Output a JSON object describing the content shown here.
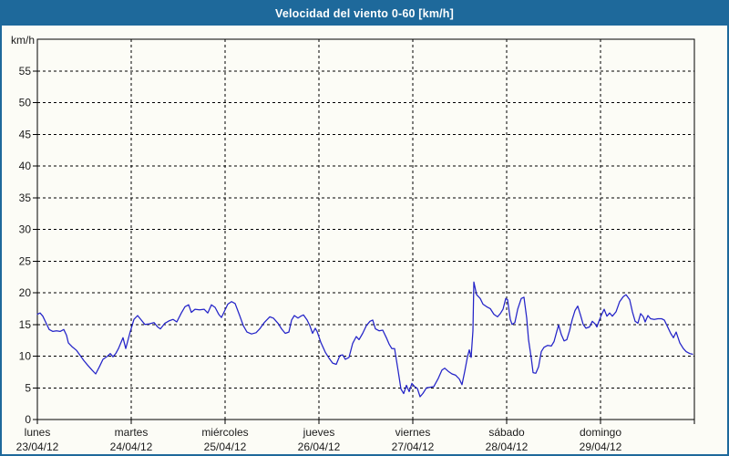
{
  "window": {
    "title": "Velocidad del viento 0-60 [km/h]"
  },
  "colors": {
    "titlebar_bg": "#1e699b",
    "frame_border": "#1e699b",
    "panel_bg": "#fcfcf6",
    "grid": "#000000",
    "axis_text": "#1a1a1a",
    "series_line": "#2323c8"
  },
  "chart_data": {
    "type": "line",
    "title": "Velocidad del viento 0-60 [km/h]",
    "xlabel": "",
    "ylabel": "km/h",
    "ylim": [
      0,
      60
    ],
    "yticks": [
      0,
      5,
      10,
      15,
      20,
      25,
      30,
      35,
      40,
      45,
      50,
      55
    ],
    "grid": "dashed",
    "legend_position": "none",
    "x_days": 7,
    "days": [
      {
        "name": "lunes",
        "date": "23/04/12"
      },
      {
        "name": "martes",
        "date": "24/04/12"
      },
      {
        "name": "miércoles",
        "date": "25/04/12"
      },
      {
        "name": "jueves",
        "date": "26/04/12"
      },
      {
        "name": "viernes",
        "date": "27/04/12"
      },
      {
        "name": "sábado",
        "date": "28/04/12"
      },
      {
        "name": "domingo",
        "date": "29/04/12"
      }
    ],
    "series": [
      {
        "name": "Velocidad del viento",
        "color": "#2323c8",
        "points": [
          [
            0.0,
            16.6
          ],
          [
            0.029,
            16.8
          ],
          [
            0.058,
            16.3
          ],
          [
            0.087,
            15.4
          ],
          [
            0.126,
            14.2
          ],
          [
            0.165,
            13.9
          ],
          [
            0.204,
            14.0
          ],
          [
            0.243,
            13.9
          ],
          [
            0.282,
            14.2
          ],
          [
            0.311,
            13.3
          ],
          [
            0.33,
            12.1
          ],
          [
            0.369,
            11.5
          ],
          [
            0.417,
            10.9
          ],
          [
            0.456,
            10.1
          ],
          [
            0.495,
            9.3
          ],
          [
            0.534,
            8.6
          ],
          [
            0.583,
            7.8
          ],
          [
            0.621,
            7.2
          ],
          [
            0.66,
            8.3
          ],
          [
            0.699,
            9.5
          ],
          [
            0.748,
            10.0
          ],
          [
            0.777,
            10.4
          ],
          [
            0.806,
            9.9
          ],
          [
            0.835,
            10.4
          ],
          [
            0.864,
            11.2
          ],
          [
            0.913,
            12.9
          ],
          [
            0.942,
            11.2
          ],
          [
            0.99,
            13.9
          ],
          [
            1.029,
            15.8
          ],
          [
            1.068,
            16.4
          ],
          [
            1.107,
            15.7
          ],
          [
            1.146,
            15.0
          ],
          [
            1.194,
            15.1
          ],
          [
            1.243,
            15.3
          ],
          [
            1.282,
            14.6
          ],
          [
            1.311,
            14.3
          ],
          [
            1.359,
            15.2
          ],
          [
            1.408,
            15.6
          ],
          [
            1.447,
            15.8
          ],
          [
            1.485,
            15.4
          ],
          [
            1.534,
            16.8
          ],
          [
            1.573,
            17.8
          ],
          [
            1.612,
            18.1
          ],
          [
            1.641,
            16.9
          ],
          [
            1.68,
            17.4
          ],
          [
            1.728,
            17.3
          ],
          [
            1.777,
            17.4
          ],
          [
            1.816,
            16.8
          ],
          [
            1.854,
            18.1
          ],
          [
            1.893,
            17.7
          ],
          [
            1.932,
            16.6
          ],
          [
            1.961,
            16.1
          ],
          [
            1.99,
            17.0
          ],
          [
            2.029,
            18.2
          ],
          [
            2.068,
            18.6
          ],
          [
            2.107,
            18.3
          ],
          [
            2.155,
            16.4
          ],
          [
            2.194,
            14.8
          ],
          [
            2.233,
            13.8
          ],
          [
            2.282,
            13.5
          ],
          [
            2.33,
            13.7
          ],
          [
            2.369,
            14.3
          ],
          [
            2.417,
            15.3
          ],
          [
            2.476,
            16.2
          ],
          [
            2.515,
            16.0
          ],
          [
            2.563,
            15.2
          ],
          [
            2.602,
            14.3
          ],
          [
            2.641,
            13.6
          ],
          [
            2.68,
            13.8
          ],
          [
            2.709,
            15.7
          ],
          [
            2.738,
            16.4
          ],
          [
            2.777,
            16.0
          ],
          [
            2.806,
            16.3
          ],
          [
            2.835,
            16.5
          ],
          [
            2.874,
            15.7
          ],
          [
            2.903,
            14.8
          ],
          [
            2.932,
            13.6
          ],
          [
            2.961,
            14.4
          ],
          [
            2.981,
            13.9
          ],
          [
            3.019,
            12.2
          ],
          [
            3.068,
            10.6
          ],
          [
            3.107,
            9.7
          ],
          [
            3.146,
            8.9
          ],
          [
            3.184,
            8.7
          ],
          [
            3.223,
            10.1
          ],
          [
            3.252,
            10.2
          ],
          [
            3.282,
            9.5
          ],
          [
            3.32,
            9.8
          ],
          [
            3.359,
            12.0
          ],
          [
            3.398,
            13.1
          ],
          [
            3.427,
            12.6
          ],
          [
            3.466,
            13.6
          ],
          [
            3.505,
            14.8
          ],
          [
            3.544,
            15.5
          ],
          [
            3.573,
            15.7
          ],
          [
            3.602,
            14.3
          ],
          [
            3.641,
            14.0
          ],
          [
            3.68,
            14.1
          ],
          [
            3.718,
            12.9
          ],
          [
            3.748,
            11.9
          ],
          [
            3.777,
            11.2
          ],
          [
            3.806,
            11.2
          ],
          [
            3.845,
            7.6
          ],
          [
            3.874,
            4.8
          ],
          [
            3.903,
            4.1
          ],
          [
            3.932,
            5.4
          ],
          [
            3.961,
            4.4
          ],
          [
            3.99,
            5.7
          ],
          [
            4.019,
            5.2
          ],
          [
            4.049,
            4.9
          ],
          [
            4.078,
            3.6
          ],
          [
            4.107,
            4.1
          ],
          [
            4.146,
            5.0
          ],
          [
            4.184,
            5.1
          ],
          [
            4.223,
            5.2
          ],
          [
            4.272,
            6.5
          ],
          [
            4.311,
            7.8
          ],
          [
            4.34,
            8.1
          ],
          [
            4.379,
            7.6
          ],
          [
            4.417,
            7.2
          ],
          [
            4.456,
            7.0
          ],
          [
            4.495,
            6.4
          ],
          [
            4.524,
            5.5
          ],
          [
            4.553,
            7.6
          ],
          [
            4.583,
            9.9
          ],
          [
            4.602,
            11.0
          ],
          [
            4.621,
            9.8
          ],
          [
            4.641,
            14.0
          ],
          [
            4.65,
            21.7
          ],
          [
            4.68,
            19.7
          ],
          [
            4.718,
            19.1
          ],
          [
            4.748,
            18.2
          ],
          [
            4.786,
            17.8
          ],
          [
            4.825,
            17.5
          ],
          [
            4.864,
            16.6
          ],
          [
            4.903,
            16.2
          ],
          [
            4.932,
            16.7
          ],
          [
            4.961,
            17.4
          ],
          [
            4.99,
            19.1
          ],
          [
            5.01,
            18.9
          ],
          [
            5.039,
            15.8
          ],
          [
            5.058,
            15.0
          ],
          [
            5.087,
            15.3
          ],
          [
            5.117,
            17.4
          ],
          [
            5.155,
            19.1
          ],
          [
            5.184,
            19.3
          ],
          [
            5.214,
            16.0
          ],
          [
            5.233,
            12.6
          ],
          [
            5.262,
            9.7
          ],
          [
            5.282,
            7.4
          ],
          [
            5.311,
            7.3
          ],
          [
            5.34,
            8.3
          ],
          [
            5.369,
            10.7
          ],
          [
            5.398,
            11.4
          ],
          [
            5.437,
            11.7
          ],
          [
            5.476,
            11.6
          ],
          [
            5.505,
            12.3
          ],
          [
            5.534,
            13.9
          ],
          [
            5.553,
            14.9
          ],
          [
            5.583,
            13.4
          ],
          [
            5.612,
            12.4
          ],
          [
            5.641,
            12.6
          ],
          [
            5.67,
            14.0
          ],
          [
            5.699,
            15.8
          ],
          [
            5.728,
            17.2
          ],
          [
            5.757,
            17.9
          ],
          [
            5.786,
            16.5
          ],
          [
            5.816,
            15.0
          ],
          [
            5.845,
            14.4
          ],
          [
            5.883,
            14.6
          ],
          [
            5.913,
            15.5
          ],
          [
            5.942,
            15.1
          ],
          [
            5.961,
            14.6
          ],
          [
            5.981,
            15.4
          ],
          [
            6.01,
            16.5
          ],
          [
            6.039,
            17.4
          ],
          [
            6.068,
            16.3
          ],
          [
            6.097,
            16.8
          ],
          [
            6.126,
            16.3
          ],
          [
            6.165,
            17.0
          ],
          [
            6.204,
            18.6
          ],
          [
            6.243,
            19.4
          ],
          [
            6.272,
            19.7
          ],
          [
            6.311,
            18.9
          ],
          [
            6.34,
            17.0
          ],
          [
            6.369,
            15.5
          ],
          [
            6.398,
            15.2
          ],
          [
            6.427,
            16.7
          ],
          [
            6.456,
            16.2
          ],
          [
            6.476,
            15.4
          ],
          [
            6.505,
            16.4
          ],
          [
            6.534,
            15.9
          ],
          [
            6.573,
            15.8
          ],
          [
            6.612,
            15.9
          ],
          [
            6.65,
            15.9
          ],
          [
            6.68,
            15.7
          ],
          [
            6.718,
            14.5
          ],
          [
            6.748,
            13.6
          ],
          [
            6.777,
            12.9
          ],
          [
            6.806,
            13.8
          ],
          [
            6.845,
            12.1
          ],
          [
            6.883,
            11.2
          ],
          [
            6.913,
            10.7
          ],
          [
            6.951,
            10.4
          ],
          [
            6.981,
            10.3
          ]
        ]
      }
    ]
  }
}
